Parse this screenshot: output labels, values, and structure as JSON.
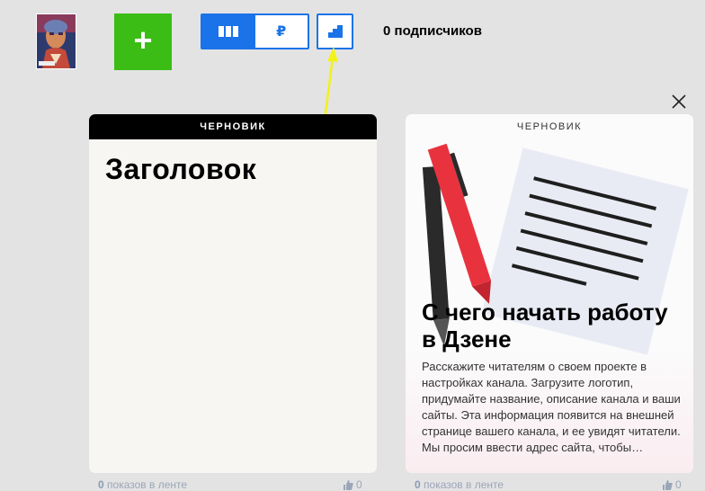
{
  "header": {
    "add_label": "+",
    "ruble_symbol": "₽",
    "subscribers_text": "0 подписчиков"
  },
  "draft_card": {
    "badge": "ЧЕРНОВИК",
    "title": "Заголовок",
    "views_count": "0",
    "views_label": "показов в ленте",
    "likes": "0"
  },
  "guide_card": {
    "badge": "ЧЕРНОВИК",
    "title": "С чего начать работу в Дзене",
    "description": "Расскажите читателям о своем проекте в настройках канала. Загрузите логотип, придумайте название, описание канала и ваши сайты. Эта информация появится на внешней странице вашего канала, и ее увидят читатели. Мы просим ввести адрес сайта, чтобы подтвердить, что вы его владелец.",
    "views_count": "0",
    "views_label": "показов в ленте",
    "likes": "0"
  },
  "colors": {
    "accent_blue": "#1a73e8",
    "add_green": "#3bbd15",
    "annotation_arrow": "#f2f21a"
  },
  "icons": [
    "avatar",
    "plus-icon",
    "feed-view-icon",
    "ruble-icon",
    "stats-icon",
    "close-icon",
    "thumb-up-icon"
  ]
}
